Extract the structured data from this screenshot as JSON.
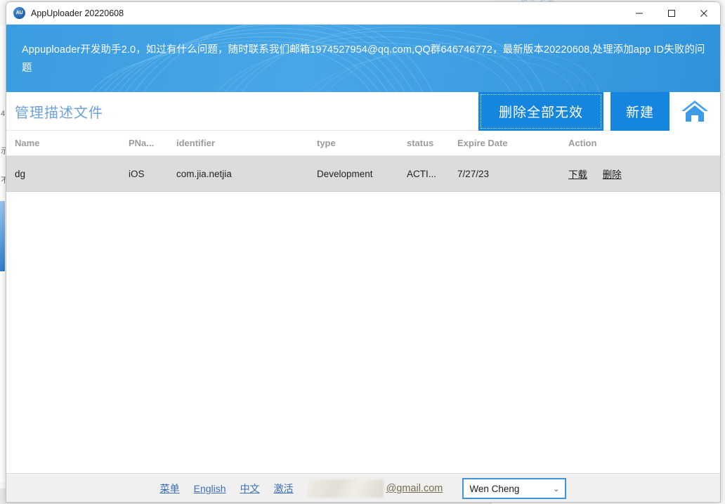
{
  "window": {
    "title": "AppUploader 20220608",
    "app_icon_label": "AU",
    "controls": {
      "minimize": "minimize-icon",
      "maximize": "maximize-icon",
      "close": "close-icon"
    }
  },
  "banner": {
    "text": "Appuploader开发助手2.0，如过有什么问题，随时联系我们邮箱1974527954@qq.com,QQ群646746772，最新版本20220608,处理添加app ID失败的问题",
    "background_color": "#3f9ee2"
  },
  "toolbar": {
    "page_title": "管理描述文件",
    "delete_invalid_label": "删除全部无效",
    "new_label": "新建",
    "home_icon": "home-icon",
    "button_color": "#1685de",
    "title_color": "#6ea2d8"
  },
  "table": {
    "columns": [
      "Name",
      "PNa...",
      "identifier",
      "type",
      "status",
      "Expire Date",
      "Action"
    ],
    "rows": [
      {
        "name": "dg",
        "pname": "iOS",
        "identifier": "com.jia.netjia",
        "type": "Development",
        "status": "ACTI...",
        "expire_date": "7/27/23",
        "actions": [
          "下载",
          "删除"
        ]
      }
    ]
  },
  "footer": {
    "links": [
      "菜单",
      "English",
      "中文",
      "激活"
    ],
    "email_suffix": "@gmail.com",
    "account_name": "Wen Cheng",
    "chevron": "⌄",
    "link_color": "#3a6fb5"
  },
  "backdrop": {
    "top_text": "提示 标题",
    "left_chars": [
      "4",
      "示",
      "不"
    ]
  }
}
